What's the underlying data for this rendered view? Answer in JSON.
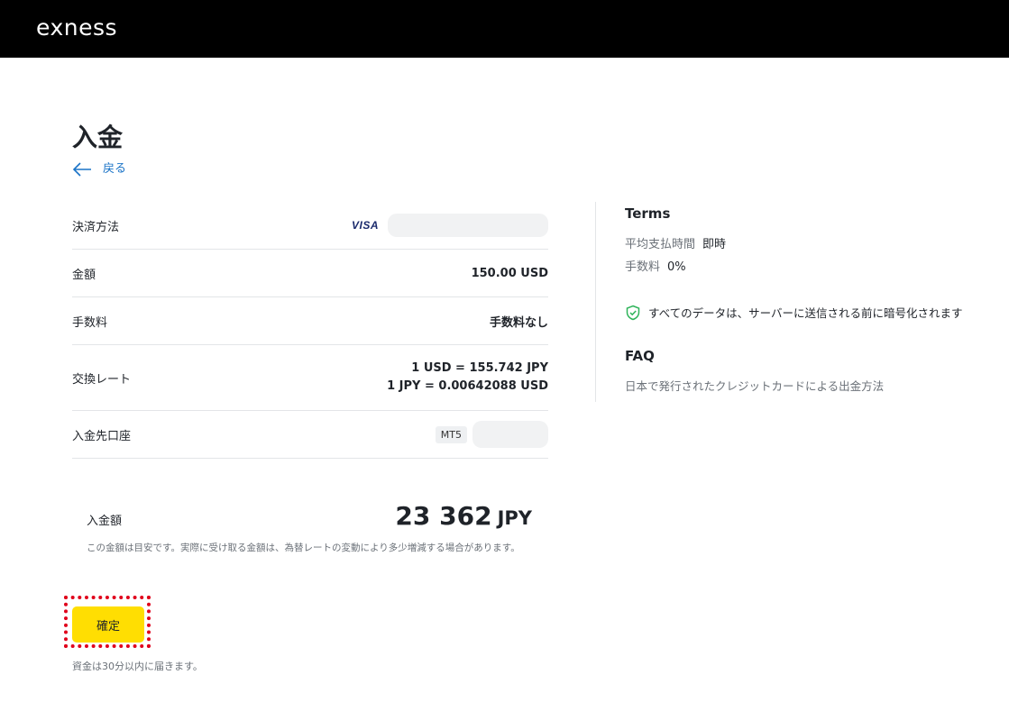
{
  "header": {
    "logo_text": "exness"
  },
  "page": {
    "title": "入金",
    "back_label": "戻る"
  },
  "details": {
    "payment_method": {
      "label": "決済方法",
      "card_brand": "VISA"
    },
    "amount": {
      "label": "金額",
      "value": "150.00 USD"
    },
    "fee": {
      "label": "手数料",
      "value": "手数料なし"
    },
    "exchange_rate": {
      "label": "交換レート",
      "value_line1": "1 USD = 155.742 JPY",
      "value_line2": "1 JPY = 0.00642088 USD"
    },
    "account": {
      "label": "入金先口座",
      "platform_badge": "MT5"
    }
  },
  "summary": {
    "label": "入金額",
    "amount": "23 362",
    "currency": "JPY",
    "disclaimer": "この金額は目安です。実際に受け取る金額は、為替レートの変動により多少増減する場合があります。"
  },
  "actions": {
    "confirm_label": "確定",
    "arrival_note": "資金は30分以内に届きます。"
  },
  "terms": {
    "title": "Terms",
    "avg_time_label": "平均支払時間",
    "avg_time_value": "即時",
    "fee_label": "手数料",
    "fee_value": "0%",
    "security_text": "すべてのデータは、サーバーに送信される前に暗号化されます"
  },
  "faq": {
    "title": "FAQ",
    "link_text": "日本で発行されたクレジットカードによる出金方法"
  },
  "colors": {
    "accent_yellow": "#ffde02",
    "link_blue": "#1a73c7",
    "highlight_red": "#e0001b",
    "shield_green": "#2fb45a"
  },
  "icons": {
    "back": "arrow-left-icon",
    "security": "shield-check-icon"
  }
}
